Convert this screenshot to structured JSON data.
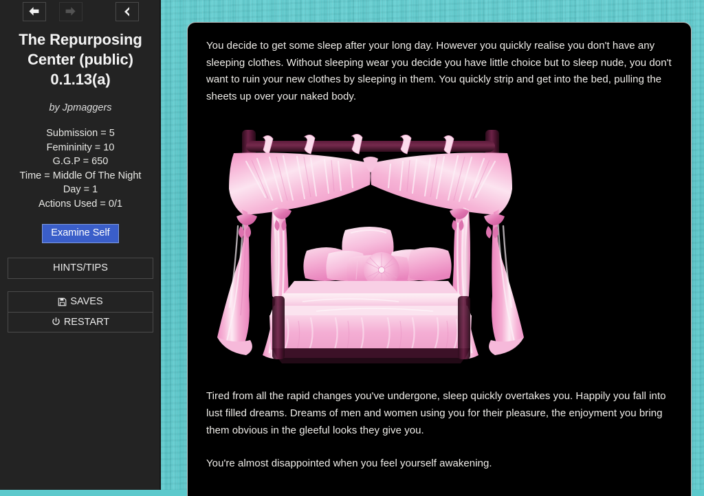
{
  "nav": {
    "back_label": "Back",
    "forward_label": "Forward",
    "collapse_label": "Collapse sidebar",
    "back_icon": "arrow-left-icon",
    "forward_icon": "arrow-right-icon",
    "collapse_icon": "chevron-left-icon"
  },
  "sidebar": {
    "title": "The Repurposing Center (public) 0.1.13(a)",
    "byline": "by Jpmaggers",
    "stats": [
      "Submission = 5",
      "Femininity = 10",
      "G.G.P = 650",
      "Time = Middle Of The Night",
      "Day = 1",
      "Actions Used = 0/1"
    ],
    "examine_label": "Examine Self",
    "hints_label": "HINTS/TIPS",
    "saves_label": "SAVES",
    "restart_label": "RESTART",
    "saves_icon": "floppy-disk-icon",
    "restart_icon": "power-icon"
  },
  "story": {
    "paragraph_1": "You decide to get some sleep after your long day. However you quickly realise you don't have any sleeping clothes. Without sleeping wear you decide you have little choice but to sleep nude, you don't want to ruin your new clothes by sleeping in them. You quickly strip and get into the bed, pulling the sheets up over your naked body.",
    "image_alt": "pink canopy four-poster bed with draped curtains and pillows",
    "paragraph_2": "Tired from all the rapid changes you've undergone, sleep quickly overtakes you. Happily you fall into lust filled dreams. Dreams of men and women using you for their pleasure, the enjoyment you bring them obvious in the gleeful looks they give you.",
    "paragraph_3": "You're almost disappointed when you feel yourself awakening."
  },
  "colors": {
    "background_teal": "#5ec9cb",
    "sidebar_dark": "#232323",
    "panel_black": "#000000",
    "accent_blue": "#3a5ec9",
    "bed_pink": "#f0a3cd",
    "bed_post_maroon": "#4a1530"
  }
}
